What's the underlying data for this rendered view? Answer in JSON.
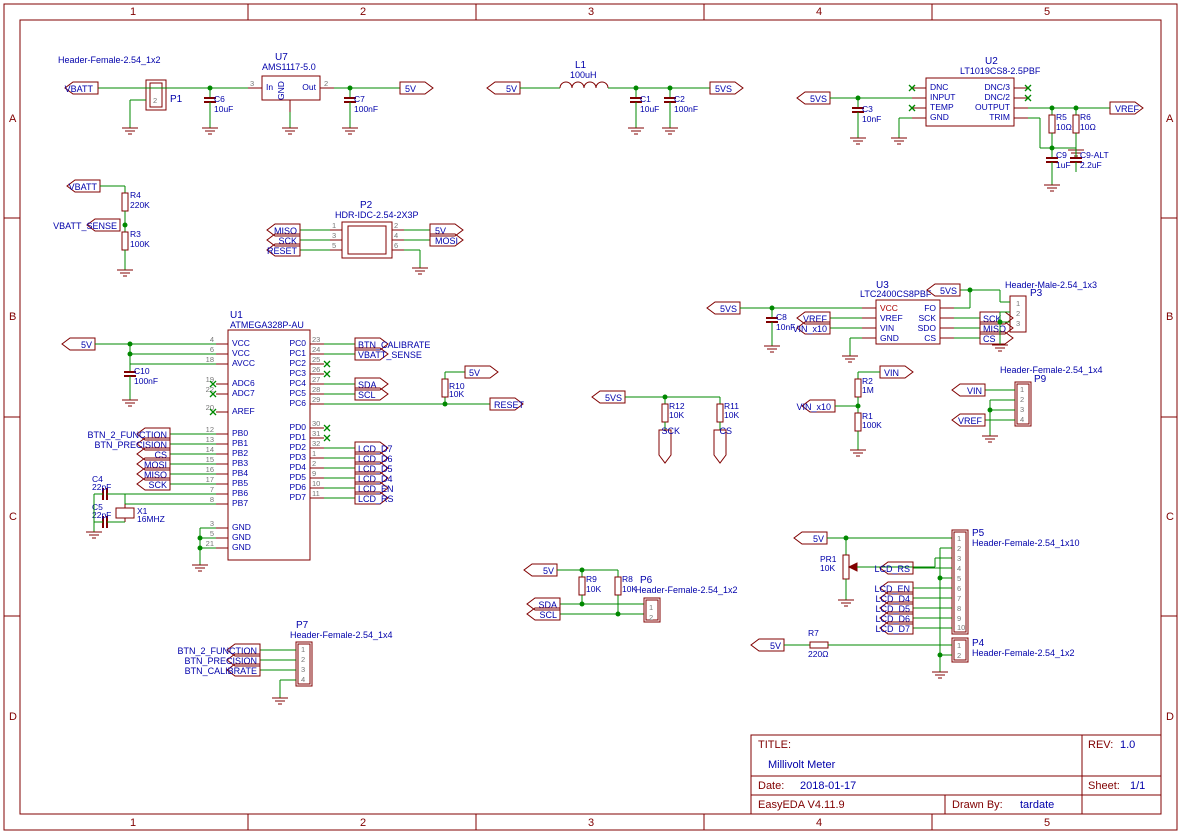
{
  "frame": {
    "cols": [
      "1",
      "2",
      "3",
      "4",
      "5"
    ],
    "rows": [
      "A",
      "B",
      "C",
      "D"
    ]
  },
  "title_block": {
    "title_label": "TITLE:",
    "title": "Millivolt Meter",
    "date_label": "Date:",
    "date": "2018-01-17",
    "drawn_label": "Drawn By:",
    "drawn": "tardate",
    "rev_label": "REV:",
    "rev": "1.0",
    "sheet_label": "Sheet:",
    "sheet": "1/1",
    "software": "EasyEDA V4.11.9"
  },
  "components": {
    "U7": {
      "ref": "U7",
      "type": "AMS1117-5.0",
      "pins": {
        "in": "In",
        "gnd": "GND",
        "out": "Out"
      },
      "pn": {
        "in": "3",
        "out": "2"
      }
    },
    "U2": {
      "ref": "U2",
      "type": "LT1019CS8-2.5PBF",
      "pins": {
        "dnc": "DNC",
        "input": "INPUT",
        "temp": "TEMP",
        "gnd": "GND",
        "dnc3": "DNC/3",
        "dnc2": "DNC/2",
        "output": "OUTPUT",
        "trim": "TRIM"
      }
    },
    "U3": {
      "ref": "U3",
      "type": "LTC2400CS8PBF",
      "pins": {
        "vcc": "VCC",
        "vref": "VREF",
        "vin": "VIN",
        "gnd": "GND",
        "fo": "FO",
        "sck": "SCK",
        "sdo": "SDO",
        "cs": "CS"
      }
    },
    "U1": {
      "ref": "U1",
      "type": "ATMEGA328P-AU"
    },
    "P1": {
      "ref": "P1",
      "type": "Header-Female-2.54_1x2"
    },
    "P2": {
      "ref": "P2",
      "type": "HDR-IDC-2.54-2X3P"
    },
    "P3": {
      "ref": "P3",
      "type": "Header-Male-2.54_1x3"
    },
    "P4": {
      "ref": "P4",
      "type": "Header-Female-2.54_1x2"
    },
    "P5": {
      "ref": "P5",
      "type": "Header-Female-2.54_1x10"
    },
    "P6": {
      "ref": "P6",
      "type": "Header-Female-2.54_1x2"
    },
    "P7": {
      "ref": "P7",
      "type": "Header-Female-2.54_1x4"
    },
    "P9": {
      "ref": "P9",
      "type": "Header-Female-2.54_1x4"
    },
    "C1": {
      "ref": "C1",
      "val": "10uF"
    },
    "C2": {
      "ref": "C2",
      "val": "100nF"
    },
    "C3": {
      "ref": "C3",
      "val": "10nF"
    },
    "C4": {
      "ref": "C4",
      "val": "22pF"
    },
    "C5": {
      "ref": "C5",
      "val": "22pF"
    },
    "C6": {
      "ref": "C6",
      "val": "10uF"
    },
    "C7": {
      "ref": "C7",
      "val": "100nF"
    },
    "C8": {
      "ref": "C8",
      "val": "10nF"
    },
    "C9": {
      "ref": "C9",
      "val": "1uF"
    },
    "C9A": {
      "ref": "C9-ALT",
      "val": "2.2uF"
    },
    "C10": {
      "ref": "C10",
      "val": "100nF"
    },
    "R1": {
      "ref": "R1",
      "val": "100K"
    },
    "R2": {
      "ref": "R2",
      "val": "1M"
    },
    "R3": {
      "ref": "R3",
      "val": "100K"
    },
    "R4": {
      "ref": "R4",
      "val": "220K"
    },
    "R5": {
      "ref": "R5",
      "val": "10Ω"
    },
    "R6": {
      "ref": "R6",
      "val": "10Ω"
    },
    "R7": {
      "ref": "R7",
      "val": "220Ω"
    },
    "R8": {
      "ref": "R8",
      "val": "10K"
    },
    "R9": {
      "ref": "R9",
      "val": "10K"
    },
    "R10": {
      "ref": "R10",
      "val": "10K"
    },
    "R11": {
      "ref": "R11",
      "val": "10K"
    },
    "R12": {
      "ref": "R12",
      "val": "10K"
    },
    "PR1": {
      "ref": "PR1",
      "val": "10K"
    },
    "X1": {
      "ref": "X1",
      "val": "16MHZ"
    },
    "L1": {
      "ref": "L1",
      "val": "100uH"
    }
  },
  "nets": {
    "VBATT": "VBATT",
    "VBATT_SENSE": "VBATT_SENSE",
    "5V": "5V",
    "5VS": "5VS",
    "VREF": "VREF",
    "MISO": "MISO",
    "MOSI": "MOSI",
    "SCK": "SCK",
    "RESET": "RESET",
    "CS": "CS",
    "SDA": "SDA",
    "SCL": "SCL",
    "BTN_CALIBRATE": "BTN_CALIBRATE",
    "BTN_PRECISION": "BTN_PRECISION",
    "BTN_2_FUNCTION": "BTN_2_FUNCTION",
    "VIN": "VIN",
    "VIN_x10": "VIN_x10",
    "LCD_RS": "LCD_RS",
    "LCD_EN": "LCD_EN",
    "LCD_D4": "LCD_D4",
    "LCD_D5": "LCD_D5",
    "LCD_D6": "LCD_D6",
    "LCD_D7": "LCD_D7"
  },
  "u1pins": {
    "VCC": "VCC",
    "AVCC": "AVCC",
    "ADC6": "ADC6",
    "ADC7": "ADC7",
    "AREF": "AREF",
    "PB0": "PB0",
    "PB1": "PB1",
    "PB2": "PB2",
    "PB3": "PB3",
    "PB4": "PB4",
    "PB5": "PB5",
    "PB6": "PB6",
    "PB7": "PB7",
    "PC0": "PC0",
    "PC1": "PC1",
    "PC2": "PC2",
    "PC3": "PC3",
    "PC4": "PC4",
    "PC5": "PC5",
    "PC6": "PC6",
    "PD0": "PD0",
    "PD1": "PD1",
    "PD2": "PD2",
    "PD3": "PD3",
    "PD4": "PD4",
    "PD5": "PD5",
    "PD6": "PD6",
    "PD7": "PD7",
    "GND": "GND"
  },
  "u1nums": {
    "VCC1": "4",
    "VCC2": "6",
    "AVCC": "18",
    "ADC6": "19",
    "ADC7": "22",
    "AREF": "20",
    "PB0": "12",
    "PB1": "13",
    "PB2": "14",
    "PB3": "15",
    "PB4": "16",
    "PB5": "17",
    "PB6": "7",
    "PB7": "8",
    "PC0": "23",
    "PC1": "24",
    "PC2": "25",
    "PC3": "26",
    "PC4": "27",
    "PC5": "28",
    "PC6": "29",
    "PD0": "30",
    "PD1": "31",
    "PD2": "32",
    "PD3": "1",
    "PD4": "2",
    "PD5": "9",
    "PD6": "10",
    "PD7": "11",
    "GND1": "3",
    "GND2": "5",
    "GND3": "21"
  }
}
